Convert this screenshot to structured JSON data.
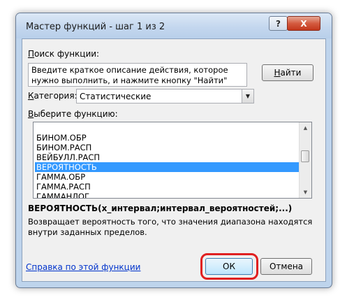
{
  "dialog": {
    "title": "Мастер функций - шаг 1 из 2",
    "help_glyph": "?",
    "close_glyph": "X"
  },
  "search": {
    "label_accel": "П",
    "label_rest": "оиск функции:",
    "text": "Введите краткое описание действия, которое нужно выполнить, и нажмите кнопку \"Найти\"",
    "find_accel": "Н",
    "find_rest": "айти"
  },
  "category": {
    "label_accel": "К",
    "label_rest": "атегория:",
    "selected": "Статистические"
  },
  "functions": {
    "label_accel": "В",
    "label_rest": "ыберите функцию:",
    "items": [
      "",
      "БИНОМ.ОБР",
      "БИНОМ.РАСП",
      "ВЕЙБУЛЛ.РАСП",
      "ВЕРОЯТНОСТЬ",
      "ГАММА.ОБР",
      "ГАММА.РАСП",
      "ГАММАНЛОГ"
    ],
    "selected_index": 4
  },
  "details": {
    "signature": "ВЕРОЯТНОСТЬ(x_интервал;интервал_вероятностей;...)",
    "description": "Возвращает вероятность того, что значения диапазона находятся внутри заданных пределов."
  },
  "footer": {
    "help_link": "Справка по этой функции",
    "ok": "ОК",
    "cancel": "Отмена"
  },
  "colors": {
    "selection": "#3399ff",
    "highlight": "#e02020",
    "link": "#0033cc"
  }
}
